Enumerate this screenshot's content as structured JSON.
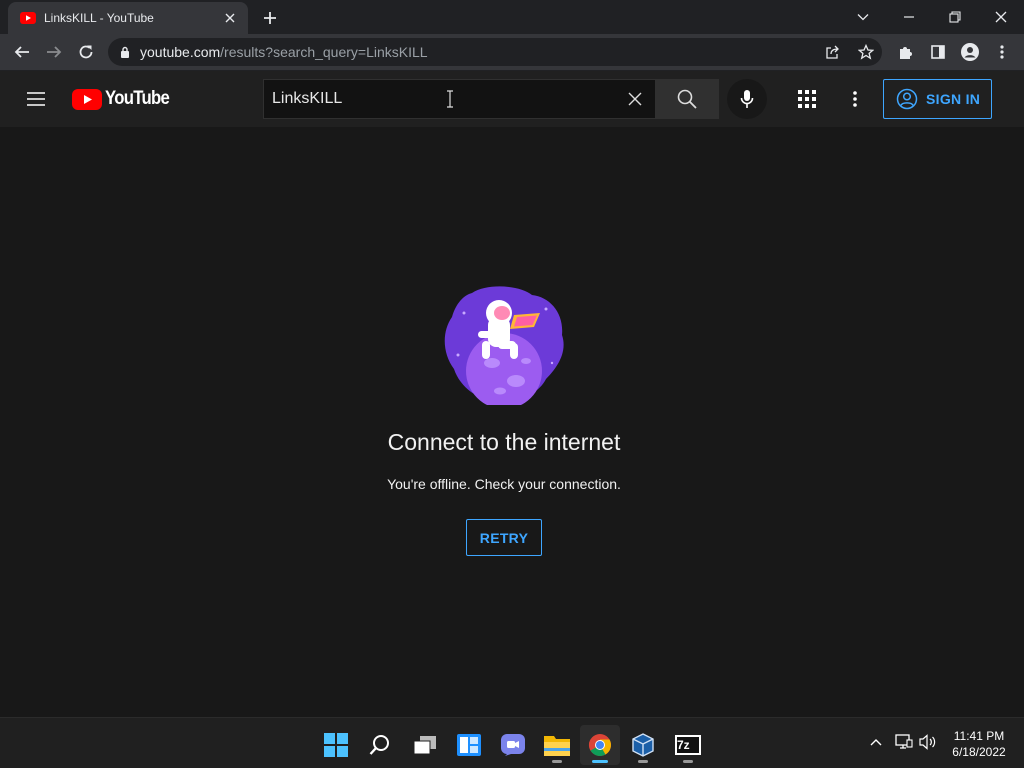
{
  "browser": {
    "tab_title": "LinksKILL - YouTube",
    "url_host": "youtube.com",
    "url_path": "/results?search_query=LinksKILL"
  },
  "youtube": {
    "logo_text": "YouTube",
    "search": {
      "value": "LinksKILL"
    },
    "sign_in_label": "SIGN IN",
    "brand_color": "#ff0000",
    "accent_color": "#3ea6ff"
  },
  "offline": {
    "title": "Connect to the internet",
    "subtitle": "You're offline. Check your connection.",
    "retry_label": "RETRY"
  },
  "taskbar": {
    "apps": [
      "start-icon",
      "search-icon",
      "task-view-icon",
      "widgets-icon",
      "chat-icon",
      "file-explorer-icon",
      "chrome-icon",
      "virtualbox-icon",
      "7zip-icon"
    ],
    "active_app": "chrome-icon",
    "sevenzip_label": "7z",
    "time": "11:41 PM",
    "date": "6/18/2022"
  }
}
